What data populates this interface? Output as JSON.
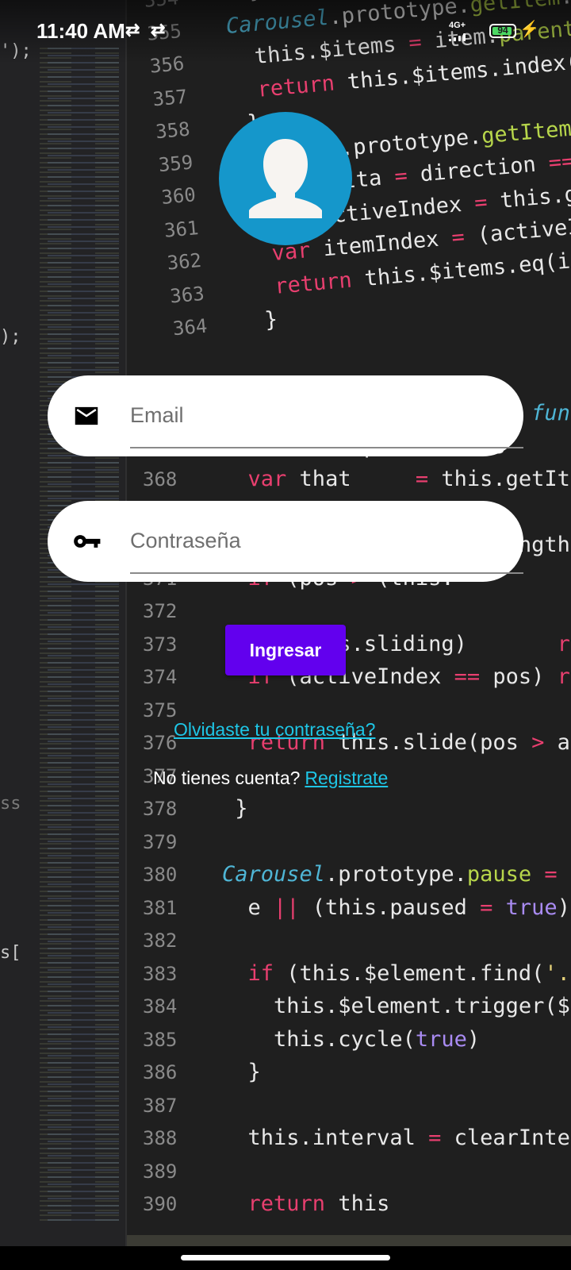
{
  "status_bar": {
    "time": "11:40 AM",
    "network": "4G+",
    "battery_level": 94,
    "battery_text": "94"
  },
  "login": {
    "email_placeholder": "Email",
    "password_placeholder": "Contraseña",
    "login_button_label": "Ingresar",
    "forgot_password_link": "Olvidaste tu contraseña?",
    "no_account_text": "No tienes cuenta?",
    "register_link": "Registrate"
  },
  "background_code": {
    "left_fragments": [
      "');",
      ");",
      "ss",
      "s["
    ]
  },
  "colors": {
    "button": "#6200ee",
    "link": "#1ec6e6",
    "avatar": "#1597cb",
    "field_bg": "#ffffff"
  },
  "icons": {
    "email": "email-icon",
    "password": "key-icon",
    "avatar": "user-avatar-icon"
  }
}
